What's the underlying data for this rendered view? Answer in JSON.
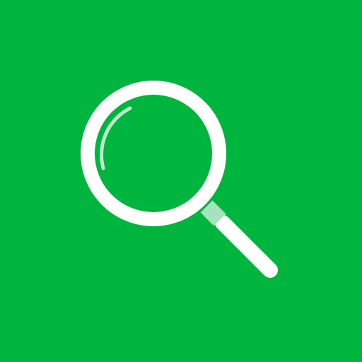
{
  "icon": {
    "name": "magnifying-glass-icon"
  },
  "colors": {
    "background": "#00b53e",
    "glass_outline": "#ffffff",
    "handle": "#ffffff",
    "ferrule": "#a6e3bd",
    "highlight": "#bfeecc"
  }
}
